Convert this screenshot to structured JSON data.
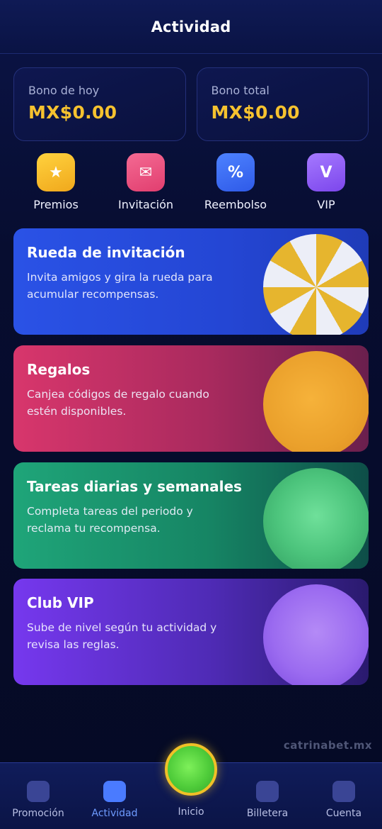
{
  "header": {
    "title": "Actividad"
  },
  "bonus": [
    {
      "label": "Bono de hoy",
      "amount": "MX$0.00"
    },
    {
      "label": "Bono total",
      "amount": "MX$0.00"
    }
  ],
  "quick_actions": [
    {
      "label": "Premios",
      "icon": "star-icon",
      "glyph": "★",
      "color": "#f5b92a"
    },
    {
      "label": "Invitación",
      "icon": "envelope-icon",
      "glyph": "✉",
      "color": "#ec4f7f"
    },
    {
      "label": "Reembolso",
      "icon": "percent-icon",
      "glyph": "%",
      "color": "#3b6cf4"
    },
    {
      "label": "VIP",
      "icon": "vip-icon",
      "glyph": "V",
      "color": "#8a55ef"
    }
  ],
  "promos": [
    {
      "title": "Rueda de invitación",
      "description": "Invita amigos y gira la rueda para acumular recompensas."
    },
    {
      "title": "Regalos",
      "description": "Canjea códigos de regalo cuando estén disponibles."
    },
    {
      "title": "Tareas diarias y semanales",
      "description": "Completa tareas del periodo y reclama tu recompensa."
    },
    {
      "title": "Club VIP",
      "description": "Sube de nivel según tu actividad y revisa las reglas."
    }
  ],
  "watermark": "catrinabet.mx",
  "bottom_nav": [
    {
      "label": "Promoción",
      "active": false
    },
    {
      "label": "Actividad",
      "active": true
    },
    {
      "label": "Inicio",
      "active": false
    },
    {
      "label": "Billetera",
      "active": false
    },
    {
      "label": "Cuenta",
      "active": false
    }
  ]
}
